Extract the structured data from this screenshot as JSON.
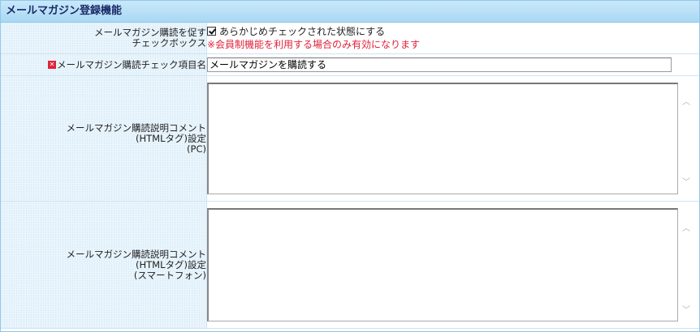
{
  "section": {
    "title": "メールマガジン登録機能"
  },
  "rows": {
    "checkbox": {
      "label_line1": "メールマガジン購読を促す",
      "label_line2": "チェックボックス",
      "option_label": "あらかじめチェックされた状態にする",
      "checked": true,
      "note": "※会員制機能を利用する場合のみ有効になります"
    },
    "item_name": {
      "required_icon": "required-icon",
      "label": "メールマガジン購読チェック項目名",
      "value": "メールマガジンを購読する"
    },
    "comment_pc": {
      "label_line1": "メールマガジン購読説明コメント",
      "label_line2": "(HTMLタグ)設定",
      "label_line3": "(PC)",
      "value": ""
    },
    "comment_sp": {
      "label_line1": "メールマガジン購読説明コメント",
      "label_line2": "(HTMLタグ)設定",
      "label_line3": "(スマートフォン)",
      "value": ""
    }
  }
}
